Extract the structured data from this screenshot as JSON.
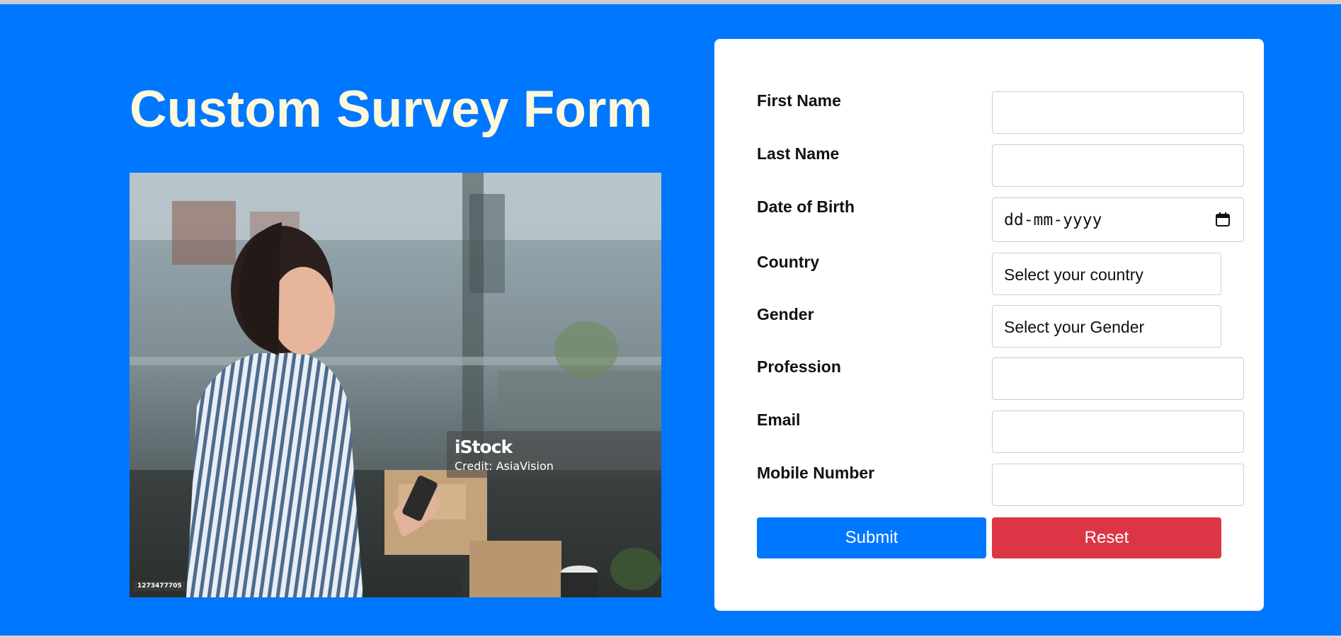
{
  "page": {
    "title": "Custom Survey Form",
    "colors": {
      "background": "#0077ff",
      "title": "#fff8dc",
      "card": "#ffffff",
      "submit": "#0077ff",
      "reset": "#dc3545"
    }
  },
  "photo": {
    "watermark_brand": "iStock",
    "watermark_credit": "Credit: AsiaVision",
    "image_id": "1273477705"
  },
  "form": {
    "first_name": {
      "label": "First Name",
      "value": ""
    },
    "last_name": {
      "label": "Last Name",
      "value": ""
    },
    "dob": {
      "label": "Date of Birth",
      "placeholder": "dd-mm-yyyy",
      "icon": "calendar-icon"
    },
    "country": {
      "label": "Country",
      "selected": "Select your country"
    },
    "gender": {
      "label": "Gender",
      "selected": "Select your Gender"
    },
    "profession": {
      "label": "Profession",
      "value": ""
    },
    "email": {
      "label": "Email",
      "value": ""
    },
    "mobile": {
      "label": "Mobile Number",
      "value": ""
    },
    "submit_label": "Submit",
    "reset_label": "Reset"
  }
}
